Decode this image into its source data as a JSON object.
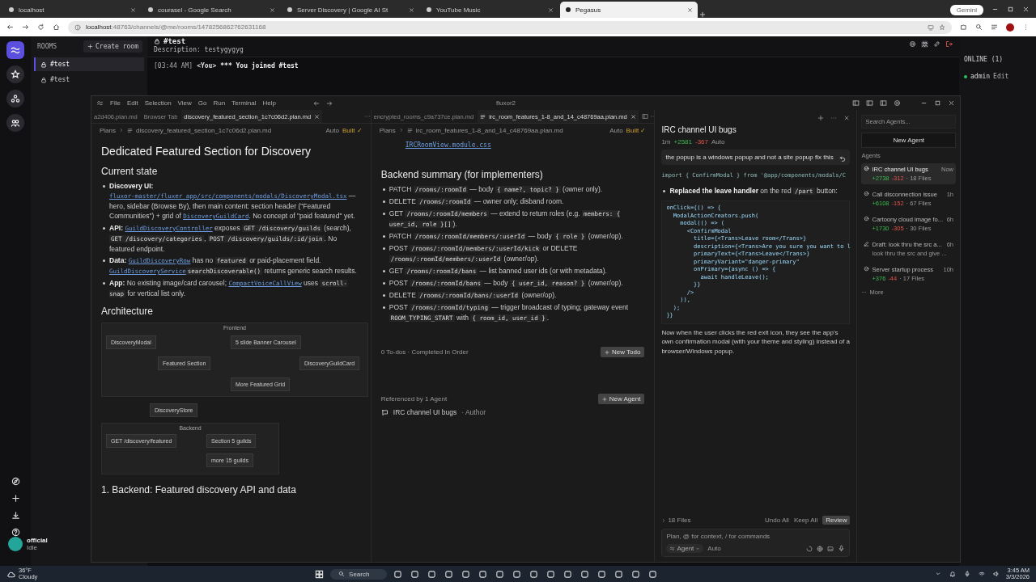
{
  "browser": {
    "tabs": [
      {
        "label": "localhost",
        "selected": false
      },
      {
        "label": "courasel - Google Search",
        "selected": false
      },
      {
        "label": "Server Discovery | Google AI St",
        "selected": false
      },
      {
        "label": "YouTube Music",
        "selected": false
      },
      {
        "label": "Pegasus",
        "selected": true
      }
    ],
    "gemini": "Gemini",
    "url_host": "localhost",
    "url_rest": ":48763/channels/@me/rooms/1478256862762631168"
  },
  "app": {
    "user": {
      "name": "official",
      "status": "Idle"
    },
    "rooms_title": "ROOMS",
    "create_room": "Create room",
    "rooms": [
      {
        "name": "#test",
        "selected": true
      },
      {
        "name": "#test",
        "selected": false
      }
    ],
    "channel": {
      "name": "#test",
      "description": "Description: testygygyg"
    },
    "messages": [
      {
        "time": "[03:44 AM]",
        "author": "<You>",
        "text": "*** You joined #test"
      }
    ],
    "online_title": "ONLINE (1)",
    "members": [
      {
        "name": "admin",
        "action": "Edit",
        "color": "#22c55e"
      }
    ]
  },
  "editor": {
    "title": "fluxor2",
    "menus": [
      "File",
      "Edit",
      "Selection",
      "View",
      "Go",
      "Run",
      "Terminal",
      "Help"
    ],
    "left": {
      "tabs": [
        {
          "label": "a2d406.plan.md",
          "selected": false
        },
        {
          "label": "Browser Tab",
          "selected": false
        },
        {
          "label": "discovery_featured_section_1c7c06d2.plan.md",
          "selected": true
        }
      ],
      "crumb_root": "Plans",
      "crumb_file": "discovery_featured_section_1c7c06d2.plan.md",
      "mode": "Auto",
      "built": "Built ✓",
      "h1": "Dedicated Featured Section for Discovery",
      "h2": "Current state",
      "bullets": [
        [
          {
            "kind": "bold",
            "text": "Discovery UI: "
          },
          {
            "kind": "link",
            "text": "fluxor-master/fluxer_app/src/components/modals/DiscoveryModal.tsx"
          },
          {
            "kind": "text",
            "text": " — hero, sidebar (Browse By), then main content: section header (\"Featured Communities\") + grid of "
          },
          {
            "kind": "link",
            "text": "DiscoveryGuildCard"
          },
          {
            "kind": "text",
            "text": ". No concept of \"paid featured\" yet."
          }
        ],
        [
          {
            "kind": "bold",
            "text": "API: "
          },
          {
            "kind": "link",
            "text": "GuildDiscoveryController"
          },
          {
            "kind": "text",
            "text": " exposes "
          },
          {
            "kind": "code",
            "text": "GET /discovery/guilds"
          },
          {
            "kind": "text",
            "text": " (search), "
          },
          {
            "kind": "code",
            "text": "GET /discovery/categories"
          },
          {
            "kind": "text",
            "text": ", "
          },
          {
            "kind": "code",
            "text": "POST /discovery/guilds/:id/join"
          },
          {
            "kind": "text",
            "text": ". No featured endpoint."
          }
        ],
        [
          {
            "kind": "bold",
            "text": "Data: "
          },
          {
            "kind": "link",
            "text": "GuildDiscoveryRow"
          },
          {
            "kind": "text",
            "text": " has no "
          },
          {
            "kind": "code",
            "text": "featured"
          },
          {
            "kind": "text",
            "text": " or paid-placement field. "
          },
          {
            "kind": "link",
            "text": "GuildDiscoveryService"
          },
          {
            "kind": "code",
            "text": "searchDiscoverable()"
          },
          {
            "kind": "text",
            "text": " returns generic search results."
          }
        ],
        [
          {
            "kind": "bold",
            "text": "App: "
          },
          {
            "kind": "text",
            "text": "No existing image/card carousel; "
          },
          {
            "kind": "link",
            "text": "CompactVoiceCallView"
          },
          {
            "kind": "text",
            "text": " uses "
          },
          {
            "kind": "code",
            "text": "scroll-snap"
          },
          {
            "kind": "text",
            "text": " for vertical list only."
          }
        ]
      ],
      "h2b": "Architecture",
      "diagram": {
        "groups": [
          "Frontend",
          "Backend"
        ],
        "nodes": [
          "DiscoveryModal",
          "Featured Section",
          "5 slide Banner Carousel",
          "More Featured Grid",
          "DiscoveryGuildCard",
          "DiscoveryStore",
          "GET /discovery/featured",
          "Section 5 guilds",
          "more 15 guilds"
        ]
      },
      "h2c": "1. Backend: Featured discovery API and data"
    },
    "middle": {
      "tabs": [
        {
          "label": "encrypted_rooms_c9a737ce.plan.md",
          "selected": false
        },
        {
          "label": "irc_room_features_1-8_and_14_c48769aa.plan.md",
          "selected": true
        }
      ],
      "crumb_root": "Plans",
      "crumb_file": "irc_room_features_1-8_and_14_c48769aa.plan.md",
      "mode": "Auto",
      "built": "Built ✓",
      "file_link": "IRCRoomView.module.css",
      "h2": "Backend summary (for implementers)",
      "bullets": [
        [
          {
            "kind": "text",
            "text": "PATCH "
          },
          {
            "kind": "code",
            "text": "/rooms/:roomId"
          },
          {
            "kind": "text",
            "text": " — body "
          },
          {
            "kind": "code",
            "text": "{ name?, topic? }"
          },
          {
            "kind": "text",
            "text": " (owner only)."
          }
        ],
        [
          {
            "kind": "text",
            "text": "DELETE "
          },
          {
            "kind": "code",
            "text": "/rooms/:roomId"
          },
          {
            "kind": "text",
            "text": " — owner only; disband room."
          }
        ],
        [
          {
            "kind": "text",
            "text": "GET "
          },
          {
            "kind": "code",
            "text": "/rooms/:roomId/members"
          },
          {
            "kind": "text",
            "text": " — extend to return roles (e.g. "
          },
          {
            "kind": "code",
            "text": "members: { user_id, role }[]"
          },
          {
            "kind": "text",
            "text": ")."
          }
        ],
        [
          {
            "kind": "text",
            "text": "PATCH "
          },
          {
            "kind": "code",
            "text": "/rooms/:roomId/members/:userId"
          },
          {
            "kind": "text",
            "text": " — body "
          },
          {
            "kind": "code",
            "text": "{ role }"
          },
          {
            "kind": "text",
            "text": " (owner/op)."
          }
        ],
        [
          {
            "kind": "text",
            "text": "POST "
          },
          {
            "kind": "code",
            "text": "/rooms/:roomId/members/:userId/kick"
          },
          {
            "kind": "text",
            "text": " or DELETE "
          },
          {
            "kind": "code",
            "text": "/rooms/:roomId/members/:userId"
          },
          {
            "kind": "text",
            "text": " (owner/op)."
          }
        ],
        [
          {
            "kind": "text",
            "text": "GET "
          },
          {
            "kind": "code",
            "text": "/rooms/:roomId/bans"
          },
          {
            "kind": "text",
            "text": " — list banned user ids (or with metadata)."
          }
        ],
        [
          {
            "kind": "text",
            "text": "POST "
          },
          {
            "kind": "code",
            "text": "/rooms/:roomId/bans"
          },
          {
            "kind": "text",
            "text": " — body "
          },
          {
            "kind": "code",
            "text": "{ user_id, reason? }"
          },
          {
            "kind": "text",
            "text": " (owner/op)."
          }
        ],
        [
          {
            "kind": "text",
            "text": "DELETE "
          },
          {
            "kind": "code",
            "text": "/rooms/:roomId/bans/:userId"
          },
          {
            "kind": "text",
            "text": " (owner/op)."
          }
        ],
        [
          {
            "kind": "text",
            "text": "POST "
          },
          {
            "kind": "code",
            "text": "/rooms/:roomId/typing"
          },
          {
            "kind": "text",
            "text": " — trigger broadcast of typing; gateway event "
          },
          {
            "kind": "code",
            "text": "ROOM_TYPING_START"
          },
          {
            "kind": "text",
            "text": " with "
          },
          {
            "kind": "code",
            "text": "{ room_id, user_id }"
          },
          {
            "kind": "text",
            "text": "."
          }
        ]
      ],
      "todos": "0 To-dos · Completed In Order",
      "new_todo": "New Todo",
      "referenced": "Referenced by 1 Agent",
      "new_agent": "New Agent",
      "ref_title": "IRC channel UI bugs",
      "ref_role": "· Author"
    },
    "chat": {
      "title": "IRC channel UI bugs",
      "age": "1m",
      "added": "+2581",
      "removed": "-367",
      "mode": "Auto",
      "user_message": "the popup is a windows popup and not a site popup fix this",
      "import_line": "import { ConfirmModal } from '@app/components/modals/C",
      "bullet": [
        {
          "kind": "bold",
          "text": "Replaced the leave handler"
        },
        {
          "kind": "text",
          "text": " on the red "
        },
        {
          "kind": "code",
          "text": "/part"
        },
        {
          "kind": "text",
          "text": " button:"
        }
      ],
      "code": [
        "onClick={() => {",
        "  ModalActionCreators.push(",
        "    modal(() => (",
        "      <ConfirmModal",
        "        title={<Trans>Leave room</Trans>}",
        "        description={<Trans>Are you sure you want to l",
        "        primaryText={<Trans>Leave</Trans>}",
        "        primaryVariant=\"danger-primary\"",
        "        onPrimary={async () => {",
        "          await handleLeave();",
        "        }}",
        "      />",
        "    )),",
        "  );",
        "}}"
      ],
      "summary": "Now when the user clicks the red exit icon, they see the app's own confirmation modal (with your theme and styling) instead of a browser/Windows popup.",
      "files": "18 Files",
      "undo": "Undo All",
      "keep": "Keep All",
      "review": "Review",
      "placeholder": "Plan, @ for context, / for commands",
      "agent": "Agent",
      "model": "Auto"
    },
    "agents": {
      "search_placeholder": "Search Agents...",
      "new_agent": "New Agent",
      "heading": "Agents",
      "items": [
        {
          "kind": "done",
          "title": "IRC channel UI bugs",
          "added": "+2738",
          "removed": "-312",
          "files": "· 18 Files",
          "time": "Now",
          "selected": true
        },
        {
          "kind": "done",
          "title": "Call disconnection issue",
          "added": "+6108",
          "removed": "-152",
          "files": "· 67 Files",
          "time": "1h",
          "selected": false
        },
        {
          "kind": "done",
          "title": "Cartoony cloud image fo...",
          "added": "+1730",
          "removed": "-305",
          "files": "· 30 Files",
          "time": "6h",
          "selected": false
        },
        {
          "kind": "draft",
          "title": "Draft: look thru the src a...",
          "subtitle": "look thru the src and give ...",
          "time": "6h",
          "selected": false
        },
        {
          "kind": "done",
          "title": "Server startup process",
          "added": "+376",
          "removed": "-44",
          "files": "· 17 Files",
          "time": "10h",
          "selected": false
        }
      ],
      "more": "More"
    }
  },
  "taskbar": {
    "temp": "36°F",
    "weather": "Cloudy",
    "search": "Search",
    "time": "3:45 AM",
    "date": "3/3/2026"
  }
}
